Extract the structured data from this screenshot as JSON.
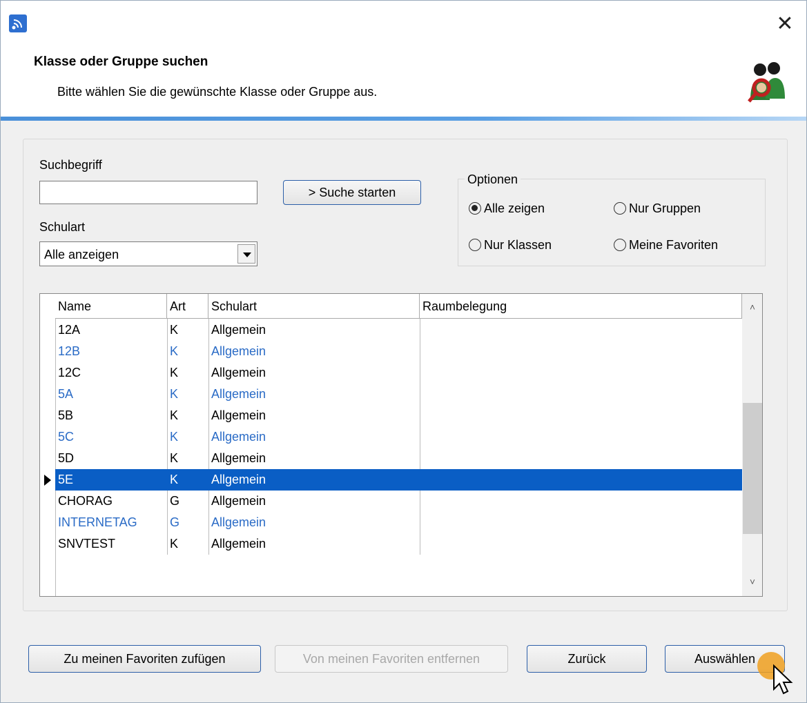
{
  "window": {
    "title": "Klasse oder Gruppe suchen",
    "subtitle": "Bitte wählen Sie die gewünschte Klasse oder Gruppe aus.",
    "close_symbol": "✕"
  },
  "search": {
    "label": "Suchbegriff",
    "value": "",
    "button_label": "> Suche starten"
  },
  "schulart": {
    "label": "Schulart",
    "selected": "Alle anzeigen"
  },
  "options": {
    "legend": "Optionen",
    "items": [
      {
        "label": "Alle zeigen",
        "checked": true
      },
      {
        "label": "Nur Gruppen",
        "checked": false
      },
      {
        "label": "Nur Klassen",
        "checked": false
      },
      {
        "label": "Meine Favoriten",
        "checked": false
      }
    ]
  },
  "table": {
    "columns": [
      "Name",
      "Art",
      "Schulart",
      "Raumbelegung"
    ],
    "rows": [
      {
        "name": "12A",
        "art": "K",
        "schulart": "Allgemein",
        "raum": "",
        "style": "normal"
      },
      {
        "name": "12B",
        "art": "K",
        "schulart": "Allgemein",
        "raum": "",
        "style": "blue"
      },
      {
        "name": "12C",
        "art": "K",
        "schulart": "Allgemein",
        "raum": "",
        "style": "normal"
      },
      {
        "name": "5A",
        "art": "K",
        "schulart": "Allgemein",
        "raum": "",
        "style": "blue"
      },
      {
        "name": "5B",
        "art": "K",
        "schulart": "Allgemein",
        "raum": "",
        "style": "normal"
      },
      {
        "name": "5C",
        "art": "K",
        "schulart": "Allgemein",
        "raum": "",
        "style": "blue"
      },
      {
        "name": "5D",
        "art": "K",
        "schulart": "Allgemein",
        "raum": "",
        "style": "normal"
      },
      {
        "name": "5E",
        "art": "K",
        "schulart": "Allgemein",
        "raum": "",
        "style": "selected"
      },
      {
        "name": "CHORAG",
        "art": "G",
        "schulart": "Allgemein",
        "raum": "",
        "style": "normal"
      },
      {
        "name": "INTERNETAG",
        "art": "G",
        "schulart": "Allgemein",
        "raum": "",
        "style": "blue"
      },
      {
        "name": "SNVTEST",
        "art": "K",
        "schulart": "Allgemein",
        "raum": "",
        "style": "normal"
      }
    ]
  },
  "buttons": {
    "add_favorite": "Zu meinen Favoriten zufügen",
    "remove_favorite": "Von meinen Favoriten entfernen",
    "back": "Zurück",
    "select": "Auswählen"
  },
  "colors": {
    "selection": "#0a5ec5",
    "link_blue": "#2a6bc6",
    "accent": "#4a90d9",
    "button_border": "#2b5ea8"
  },
  "icons": {
    "app": "app-signal-icon",
    "logo": "people-search-icon",
    "close": "close-icon"
  }
}
